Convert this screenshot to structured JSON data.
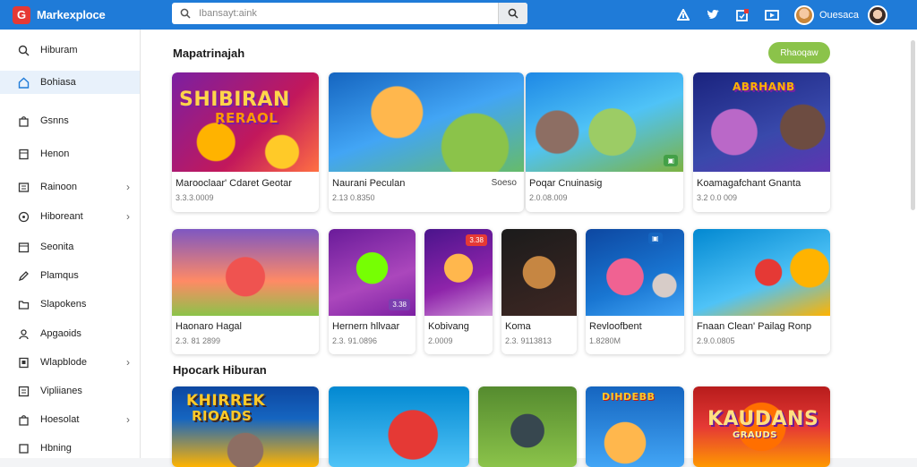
{
  "brand": {
    "name": "Markexploce",
    "logo_letter": "G"
  },
  "search": {
    "value": "Ibansayt:aink"
  },
  "user": {
    "name": "Ouesaca"
  },
  "sidebar": {
    "items": [
      {
        "label": "Hiburam",
        "icon": "search-icon"
      },
      {
        "label": "Bohiasa",
        "icon": "home-icon",
        "active": true
      },
      {
        "label": "Gsnns",
        "icon": "bag-icon"
      },
      {
        "label": "Henon",
        "icon": "document-icon"
      },
      {
        "label": "Rainoon",
        "icon": "image-icon",
        "chevron": true
      },
      {
        "label": "Hiboreant",
        "icon": "circle-icon",
        "chevron": true
      },
      {
        "label": "Seonita",
        "icon": "calendar-icon"
      },
      {
        "label": "Plamqus",
        "icon": "pen-icon"
      },
      {
        "label": "Slapokens",
        "icon": "folder-icon"
      },
      {
        "label": "Apgaoids",
        "icon": "user-icon"
      },
      {
        "label": "Wlapblode",
        "icon": "bookmark-icon",
        "chevron": true
      },
      {
        "label": "Vipliianes",
        "icon": "list-icon"
      },
      {
        "label": "Hoesolat",
        "icon": "bag-icon",
        "chevron": true
      },
      {
        "label": "Hbning",
        "icon": "star-icon"
      }
    ]
  },
  "main": {
    "section1_title": "Mapatrinajah",
    "section1_button": "Rhaoqaw",
    "section2_title": "Hpocark Hiburan",
    "row1": [
      {
        "title": "Marooclaar' Cdaret Geotar",
        "sub": "3.3.3.0009",
        "thumb_text": "SHIBIRAN",
        "thumb_text2": "RERAOL"
      },
      {
        "title": "Naurani Peculan",
        "sub": "2.13 0.8350",
        "tag": "Soeso"
      },
      {
        "title": "Poqar Cnuinasig",
        "sub": "2.0.08.009"
      },
      {
        "title": "Koamagafchant Gnanta",
        "sub": "3.2 0.0 009",
        "thumb_text": "ABRHANB"
      }
    ],
    "row2": [
      {
        "title": "Haonaro Hagal",
        "sub": "2.3. 81 2899"
      },
      {
        "title": "Hernern hllvaar",
        "sub": "2.3. 91.0896",
        "badge": "3.38"
      },
      {
        "title": "Kobivang",
        "sub": "2.0009",
        "badge": "3.38"
      },
      {
        "title": "Koma",
        "sub": "2.3. 9113813"
      },
      {
        "title": "Revloofbent",
        "sub": "1.8280M"
      },
      {
        "title": "Fnaan Clean' Pailag Ronp",
        "sub": "2.9.0.0805"
      }
    ],
    "row3": [
      {
        "thumb_text": "KHIRREK",
        "thumb_text2": "RIOADS"
      },
      {},
      {},
      {
        "thumb_text": "DIHDEBB"
      },
      {
        "thumb_text": "KAUDANS",
        "thumb_text2": "GRAUDS"
      }
    ]
  }
}
